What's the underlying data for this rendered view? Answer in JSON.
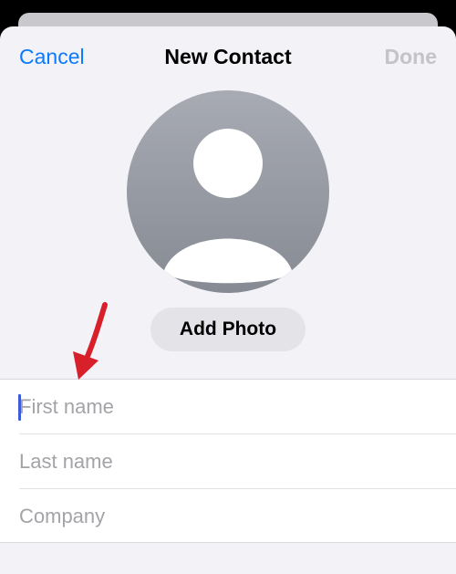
{
  "nav": {
    "cancel_label": "Cancel",
    "title": "New Contact",
    "done_label": "Done"
  },
  "avatar": {
    "icon": "person-placeholder-icon"
  },
  "add_photo_label": "Add Photo",
  "form": {
    "first_name_placeholder": "First name",
    "last_name_placeholder": "Last name",
    "company_placeholder": "Company"
  },
  "colors": {
    "accent": "#0a7aff",
    "disabled": "#c4c4c7",
    "annotation_arrow": "#d8202a",
    "background": "#f2f2f7"
  }
}
